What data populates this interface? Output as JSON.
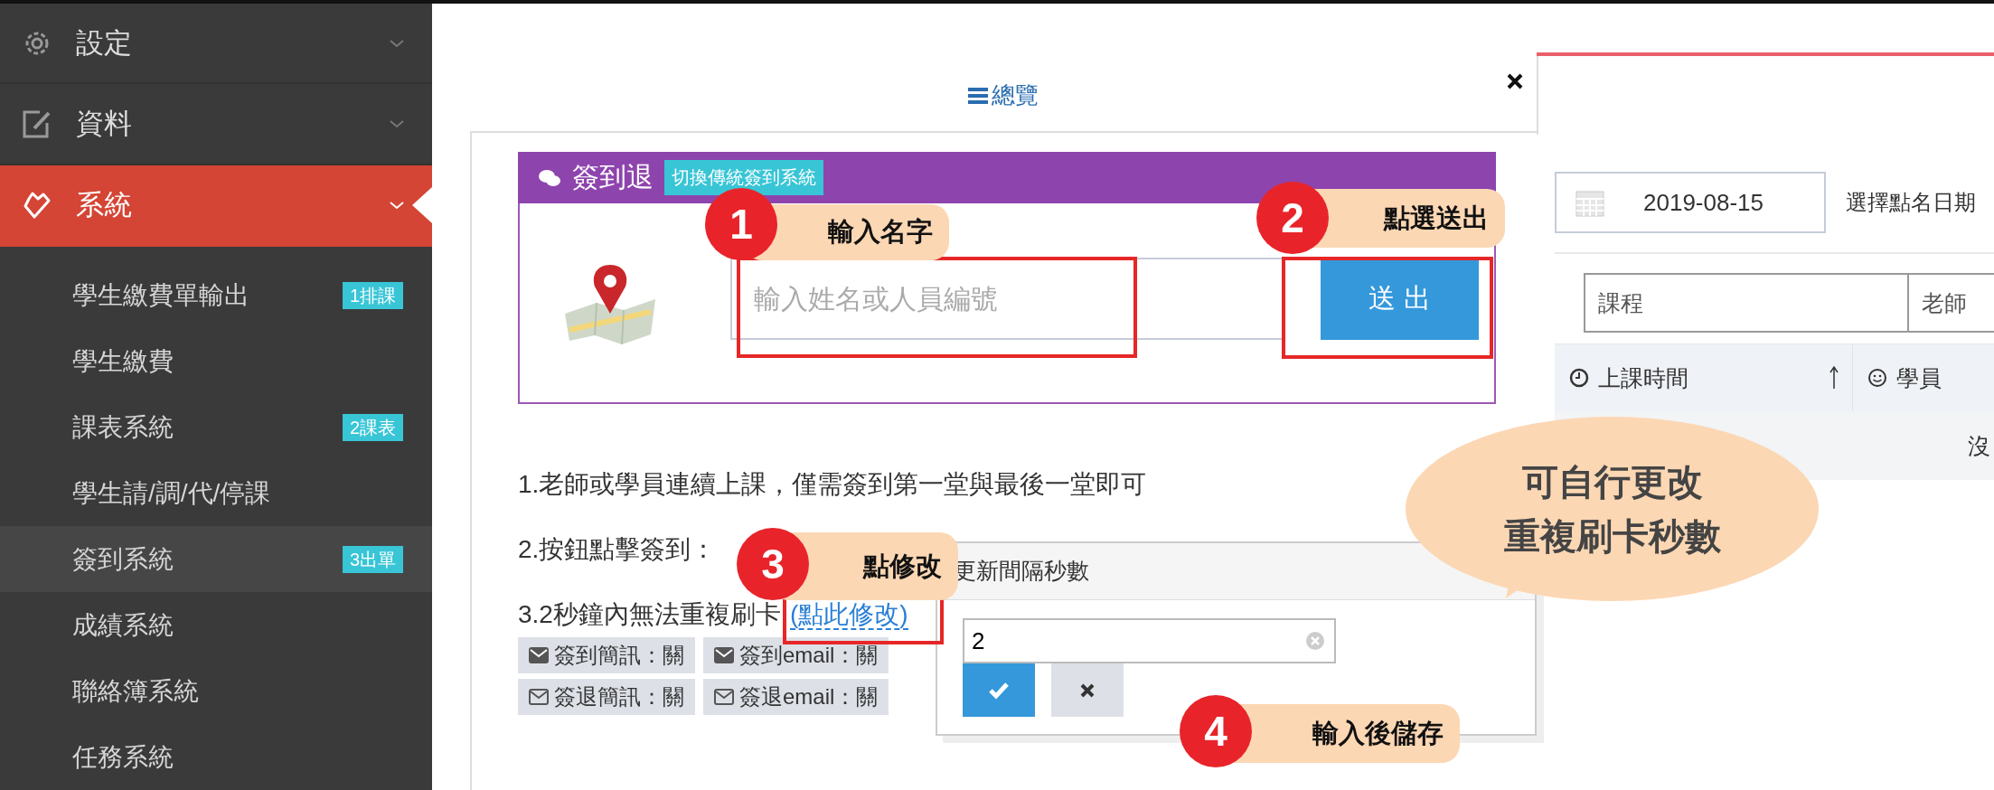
{
  "sidebar": {
    "items": [
      {
        "label": "設定",
        "selected": false,
        "expanded": false
      },
      {
        "label": "資料",
        "selected": false,
        "expanded": false
      },
      {
        "label": "系統",
        "selected": true,
        "expanded": true,
        "children": [
          {
            "label": "學生繳費單輸出",
            "badge": "1排課",
            "selected": false
          },
          {
            "label": "學生繳費",
            "selected": false
          },
          {
            "label": "課表系統",
            "badge": "2課表",
            "selected": false
          },
          {
            "label": "學生請/調/代/停課",
            "selected": false
          },
          {
            "label": "簽到系統",
            "badge": "3出單",
            "selected": true
          },
          {
            "label": "成績系統",
            "selected": false
          },
          {
            "label": "聯絡簿系統",
            "selected": false
          },
          {
            "label": "任務系統",
            "selected": false
          }
        ]
      }
    ]
  },
  "tabs": [
    {
      "label": "總覽",
      "selected": false
    }
  ],
  "checkin_card": {
    "title": "簽到退",
    "switch_badge": "切換傳統簽到系統",
    "search": {
      "placeholder": "輸入姓名或人員編號"
    },
    "submit_button": "送 出"
  },
  "instructions": [
    {
      "text": "1.老師或學員連續上課，僅需簽到第一堂與最後一堂即可"
    },
    {
      "text": "2.按鈕點擊簽到："
    },
    {
      "text": "3.2秒鐘內無法重複刷卡",
      "link": "(點此修改)"
    }
  ],
  "notification_tags": [
    {
      "kind": "filled",
      "items": [
        "簽到簡訊：關",
        "簽到email：關"
      ]
    },
    {
      "kind": "outline",
      "items": [
        "簽退簡訊：關",
        "簽退email：關"
      ]
    }
  ],
  "interval_popup": {
    "title": "更新間隔秒數",
    "value": "2"
  },
  "attendance": {
    "date": "2019-08-15",
    "date_label": "選擇點名日期",
    "filters": [
      "課程",
      "老師"
    ],
    "columns": [
      "上課時間",
      "學員"
    ],
    "sort_ascending": true,
    "empty_text": "沒"
  },
  "annotations": [
    {
      "number": "1",
      "label": "輸入名字"
    },
    {
      "number": "2",
      "label": "點選送出"
    },
    {
      "number": "3",
      "label": "點修改"
    },
    {
      "number": "4",
      "label": "輸入後儲存"
    }
  ],
  "callout": {
    "lines": [
      "可自行更改",
      "重複刷卡秒數"
    ]
  }
}
